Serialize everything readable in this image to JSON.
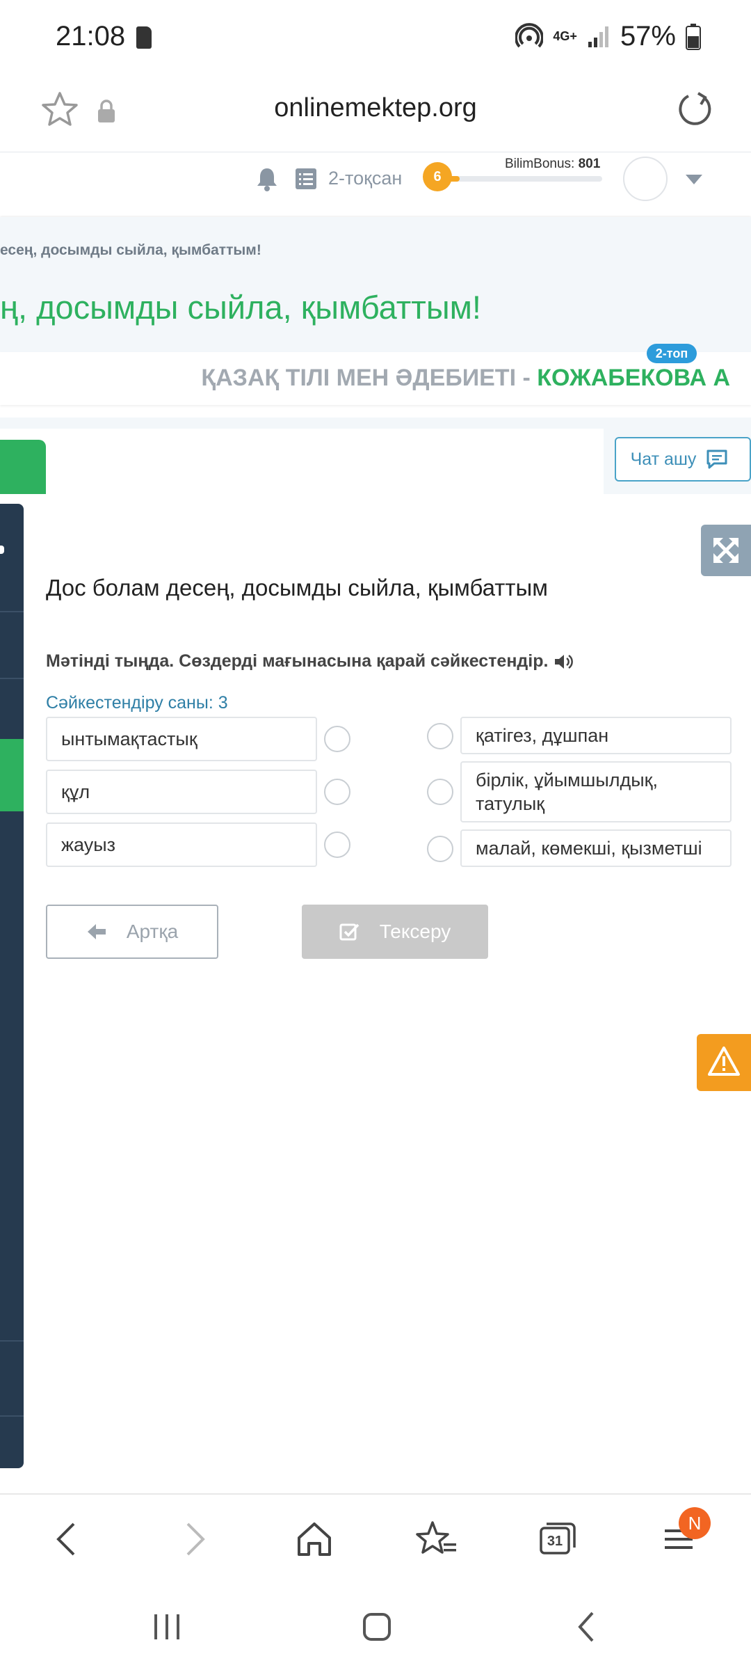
{
  "status_bar": {
    "time": "21:08",
    "network": "4G+",
    "battery": "57%"
  },
  "browser": {
    "url": "onlinemektep.org"
  },
  "header": {
    "quarter": "2-тоқсан",
    "level": "6",
    "bonus_label": "BilimBonus:",
    "bonus_value": "801",
    "bonus_progress": 0.13
  },
  "lesson": {
    "breadcrumb": "есең, досымды сыйла, қымбаттым!",
    "title": "ң, досымды сыйла, қымбаттым!",
    "subject": "ҚАЗАҚ ТІЛІ МЕН ӘДЕБИЕТІ - ",
    "teacher": "КОЖАБЕКОВА А",
    "group": "2-топ",
    "chat_label": "Чат ашу"
  },
  "task": {
    "title": "Дос болам десең, досымды сыйла, қымбаттым",
    "instruction": "Мәтінді тыңда. Сөздерді мағынасына қарай сәйкестендір.",
    "count_label": "Сәйкестендіру саны: 3",
    "left_items": [
      "ынтымақтастық",
      "құл",
      "жауыз"
    ],
    "right_items": [
      "қатігез, дұшпан",
      "бірлік, ұйымшылдық, татулық",
      "малай, көмекші, қызметші"
    ],
    "back_label": "Артқа",
    "check_label": "Тексеру"
  },
  "browser_nav": {
    "tabs_count": "31",
    "menu_badge": "N"
  }
}
